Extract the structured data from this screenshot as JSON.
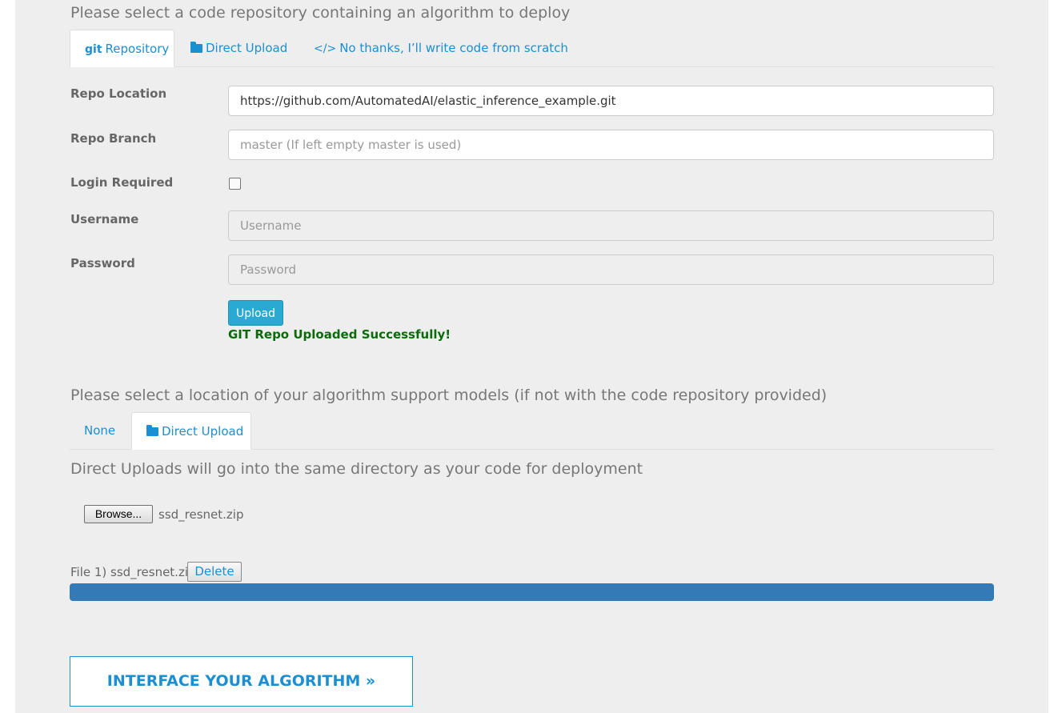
{
  "repo_section": {
    "heading": "Please select a code repository containing an algorithm to deploy",
    "tabs": [
      {
        "icon": "git-icon",
        "glyph": "git",
        "label": "Repository",
        "active": true
      },
      {
        "icon": "folder-icon",
        "label": "Direct Upload",
        "active": false
      },
      {
        "icon": "code-icon",
        "glyph": "</>",
        "label": "No thanks, I’ll write code from scratch",
        "active": false
      }
    ]
  },
  "form": {
    "repo_location": {
      "label": "Repo Location",
      "value": "https://github.com/AutomatedAI/elastic_inference_example.git"
    },
    "repo_branch": {
      "label": "Repo Branch",
      "value": "",
      "placeholder": "master (If left empty master is used)"
    },
    "login_required": {
      "label": "Login Required",
      "checked": false
    },
    "username": {
      "label": "Username",
      "value": "",
      "placeholder": "Username",
      "disabled": true
    },
    "password": {
      "label": "Password",
      "value": "",
      "placeholder": "Password",
      "disabled": true
    },
    "upload_button": "Upload",
    "success_message": "GIT Repo Uploaded Successfully!"
  },
  "models_section": {
    "heading": "Please select a location of your algorithm support models (if not with the code repository provided)",
    "tabs": [
      {
        "label": "None",
        "active": false
      },
      {
        "icon": "folder-icon",
        "label": "Direct Upload",
        "active": true
      }
    ],
    "note": "Direct Uploads will go into the same directory as your code for deployment",
    "browse_button": "Browse...",
    "selected_file": "ssd_resnet.zip",
    "files": [
      {
        "label": "File 1) ssd_resnet.zip",
        "delete_label": "Delete",
        "progress": 1.0
      }
    ]
  },
  "interface_button": "INTERFACE YOUR ALGORITHM »",
  "colors": {
    "accent": "#1b8fd1",
    "upload_button": "#2aa9d3",
    "success": "#0b6b0b",
    "progress": "#337ab7",
    "panel_bg": "#eeeeee"
  }
}
